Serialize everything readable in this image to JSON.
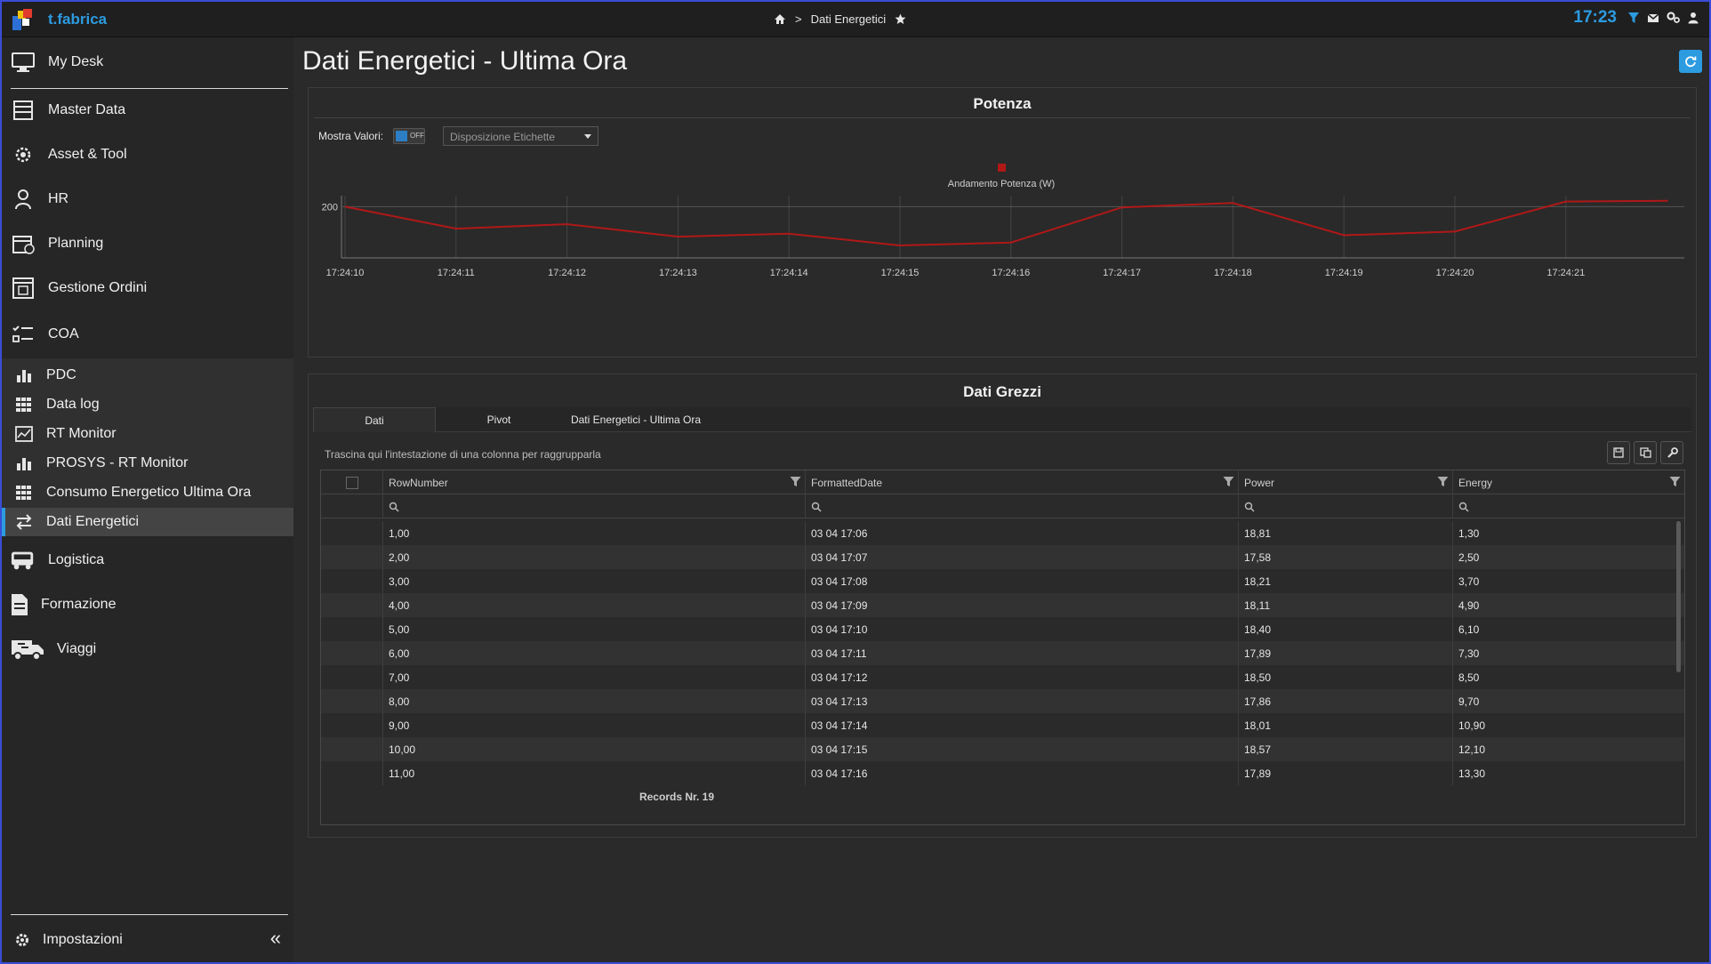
{
  "app": {
    "brand": "t.fabrica",
    "clock": "17:23"
  },
  "breadcrumb": {
    "current": "Dati Energetici",
    "separator": ">"
  },
  "sidebar": {
    "items": [
      {
        "label": "My Desk",
        "icon": "monitor-icon"
      },
      {
        "label": "Master Data",
        "icon": "database-icon"
      },
      {
        "label": "Asset & Tool",
        "icon": "gears-icon"
      },
      {
        "label": "HR",
        "icon": "person-icon"
      },
      {
        "label": "Planning",
        "icon": "calendar-icon"
      },
      {
        "label": "Gestione Ordini",
        "icon": "orders-icon"
      },
      {
        "label": "COA",
        "icon": "checklist-icon"
      }
    ],
    "sub_items": [
      {
        "label": "PDC",
        "icon": "bar-chart-icon"
      },
      {
        "label": "Data log",
        "icon": "grid-icon"
      },
      {
        "label": "RT Monitor",
        "icon": "monitor-chart-icon"
      },
      {
        "label": "PROSYS - RT Monitor",
        "icon": "bar-chart-icon"
      },
      {
        "label": "Consumo Energetico Ultima Ora",
        "icon": "grid-icon"
      },
      {
        "label": "Dati Energetici",
        "icon": "exchange-icon",
        "active": true
      }
    ],
    "items_after": [
      {
        "label": "Logistica",
        "icon": "truck-icon"
      },
      {
        "label": "Formazione",
        "icon": "document-icon"
      },
      {
        "label": "Viaggi",
        "icon": "van-icon"
      }
    ],
    "settings_label": "Impostazioni"
  },
  "page": {
    "title": "Dati Energetici - Ultima Ora"
  },
  "chart_panel": {
    "title": "Potenza",
    "mostra_label": "Mostra Valori:",
    "toggle_label": "OFF",
    "select_placeholder": "Disposizione Etichette"
  },
  "chart_data": {
    "type": "line",
    "title": "Potenza",
    "legend": [
      "Andamento Potenza (W)"
    ],
    "legend_position": "top-center",
    "x_ticks": [
      "17:24:10",
      "17:24:11",
      "17:24:12",
      "17:24:13",
      "17:24:14",
      "17:24:15",
      "17:24:16",
      "17:24:17",
      "17:24:18",
      "17:24:19",
      "17:24:20",
      "17:24:21"
    ],
    "y_ticks": [
      200
    ],
    "grid": true,
    "series_color": "#b01818",
    "series": [
      {
        "name": "Andamento Potenza (W)",
        "x": [
          0,
          1,
          2,
          3,
          4,
          5,
          6,
          7,
          8,
          9,
          10,
          11,
          12
        ],
        "values": [
          200,
          170,
          176,
          159,
          163,
          147,
          151,
          199,
          205,
          161,
          166,
          207,
          208
        ]
      }
    ]
  },
  "data_panel": {
    "title": "Dati Grezzi",
    "tabs": [
      "Dati",
      "Pivot",
      "Dati Energetici - Ultima Ora"
    ],
    "group_hint": "Trascina qui l'intestazione di una colonna per raggrupparla",
    "columns": [
      "RowNumber",
      "FormattedDate",
      "Power",
      "Energy"
    ],
    "rows": [
      [
        "1,00",
        "03 04 17:06",
        "18,81",
        "1,30"
      ],
      [
        "2,00",
        "03 04 17:07",
        "17,58",
        "2,50"
      ],
      [
        "3,00",
        "03 04 17:08",
        "18,21",
        "3,70"
      ],
      [
        "4,00",
        "03 04 17:09",
        "18,11",
        "4,90"
      ],
      [
        "5,00",
        "03 04 17:10",
        "18,40",
        "6,10"
      ],
      [
        "6,00",
        "03 04 17:11",
        "17,89",
        "7,30"
      ],
      [
        "7,00",
        "03 04 17:12",
        "18,50",
        "8,50"
      ],
      [
        "8,00",
        "03 04 17:13",
        "17,86",
        "9,70"
      ],
      [
        "9,00",
        "03 04 17:14",
        "18,01",
        "10,90"
      ],
      [
        "10,00",
        "03 04 17:15",
        "18,57",
        "12,10"
      ],
      [
        "11,00",
        "03 04 17:16",
        "17,89",
        "13,30"
      ]
    ],
    "records_label": "Records Nr. 19"
  },
  "colors": {
    "accent": "#2c9be0",
    "line": "#b01818",
    "frame": "#3a4dd6"
  }
}
